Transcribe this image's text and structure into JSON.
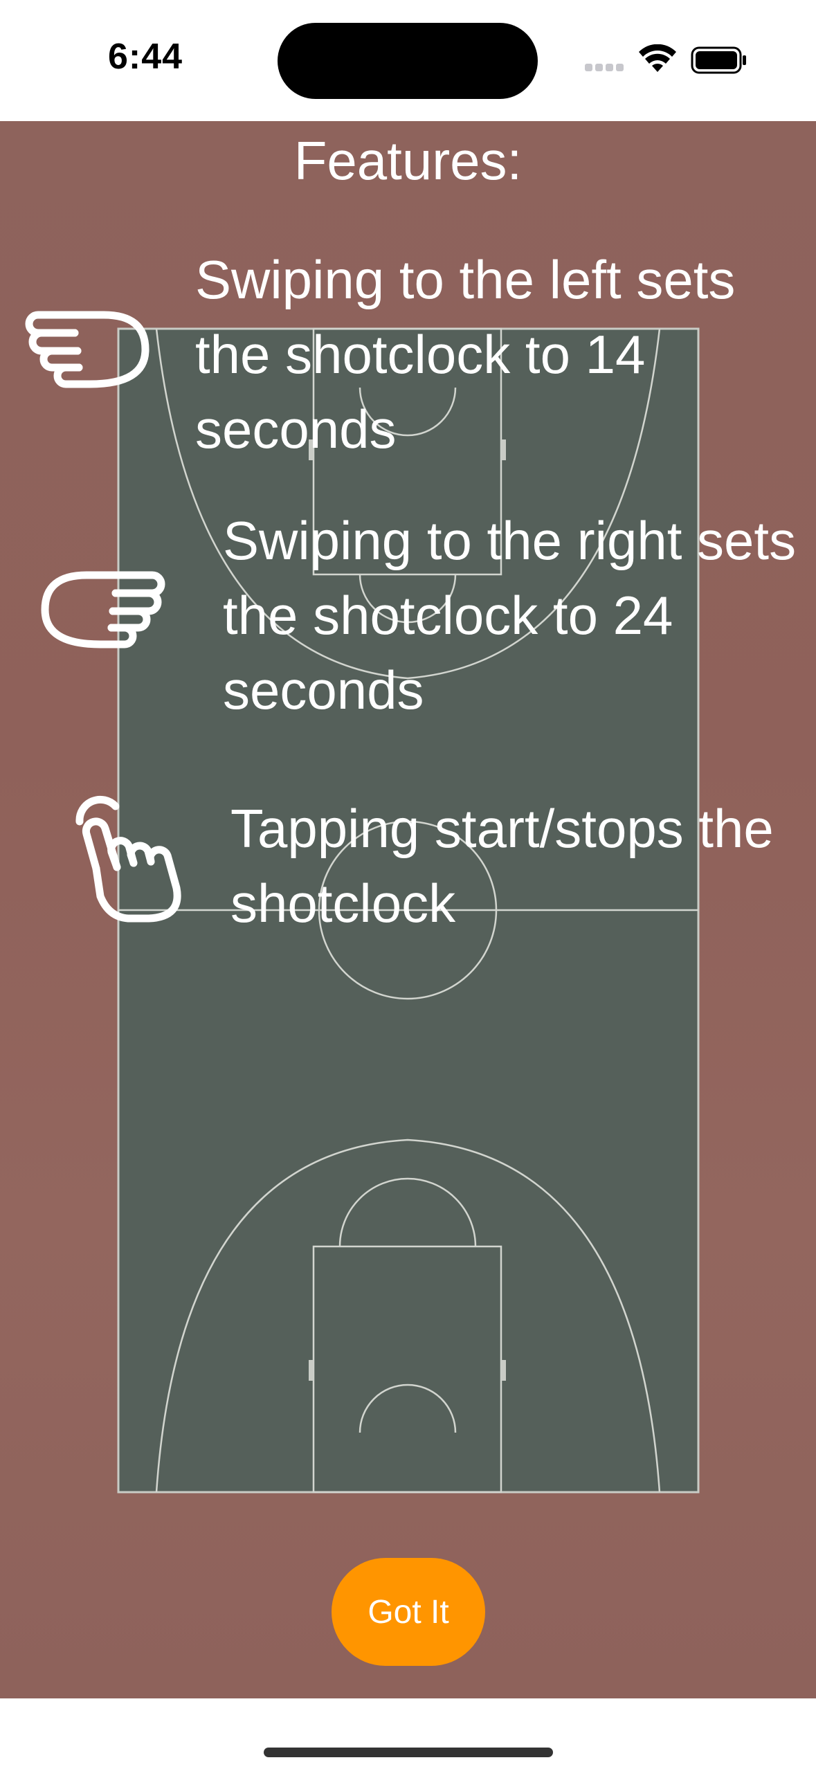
{
  "status_bar": {
    "time": "6:44"
  },
  "instructions": {
    "title": "Features:",
    "features": [
      {
        "text": "Swiping to the left sets the shotclock to 14 seconds",
        "icon": "hand-pointing-left-icon"
      },
      {
        "text": "Swiping to the right sets the shotclock to 24 seconds",
        "icon": "hand-pointing-right-icon"
      },
      {
        "text": "Tapping start/stops the shotclock",
        "icon": "hand-tap-icon"
      }
    ]
  },
  "actions": {
    "got_it_label": "Got It"
  },
  "colors": {
    "accent": "#ff9500",
    "court_surface": "#55605a",
    "court_surround": "#8e635c",
    "text": "#ffffff"
  }
}
